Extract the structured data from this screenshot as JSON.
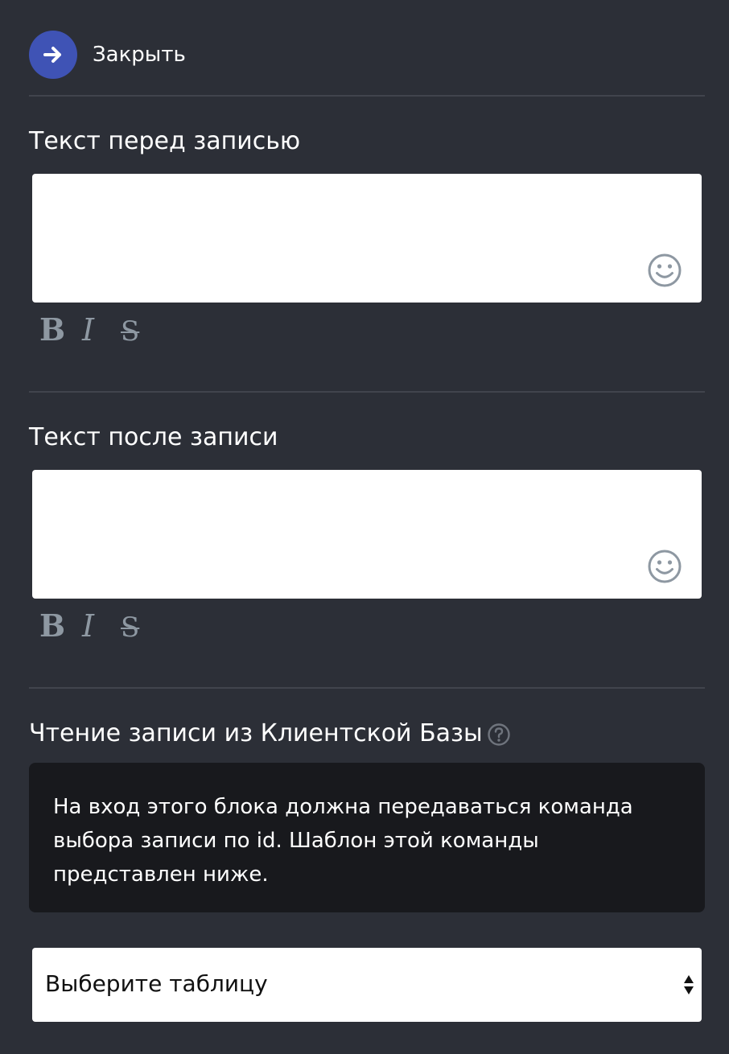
{
  "header": {
    "close_label": "Закрыть",
    "close_icon": "arrow-right-icon"
  },
  "sections": [
    {
      "title": "Текст перед записью",
      "editor_value": "",
      "emoji_icon": "smile-icon",
      "format_buttons": [
        "B",
        "I",
        "S"
      ]
    },
    {
      "title": "Текст после записи",
      "editor_value": "",
      "emoji_icon": "smile-icon",
      "format_buttons": [
        "B",
        "I",
        "S"
      ]
    }
  ],
  "read_record": {
    "title": "Чтение записи из Клиентской Базы",
    "help_icon": "question-circle-icon",
    "info_lines": [
      "На вход этого блока должна передаваться команда",
      "выбора записи по id. Шаблон этой команды",
      "представлен ниже."
    ]
  },
  "table_select": {
    "selected": "Выберите таблицу",
    "arrow_icon": "sort-arrows-icon"
  },
  "colors": {
    "background": "#2c2f37",
    "accent": "#3f53b5",
    "info_box": "#18191d",
    "format_icons": "#8e98a2"
  }
}
